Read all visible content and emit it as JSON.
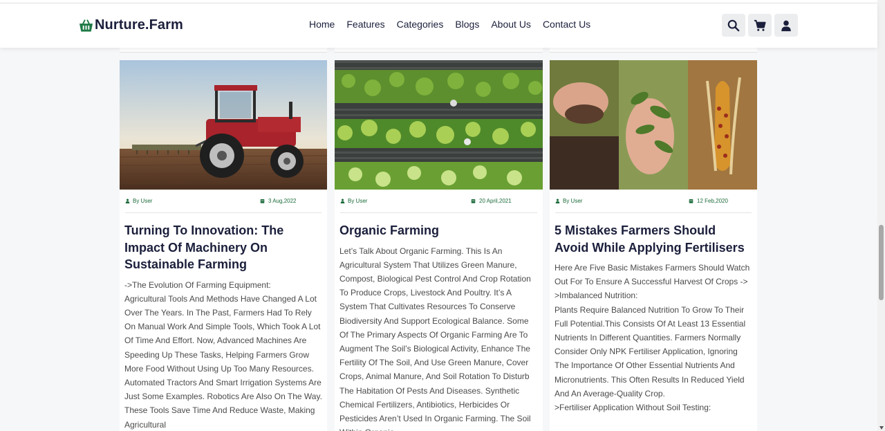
{
  "header": {
    "logo_text": "Nurture.Farm",
    "nav": [
      "Home",
      "Features",
      "Categories",
      "Blogs",
      "About Us",
      "Contact Us"
    ],
    "icons": [
      "search-icon",
      "cart-icon",
      "user-icon"
    ]
  },
  "colors": {
    "brand_green": "#1f7a45",
    "navy": "#1b1f3b",
    "meta_green": "#1b6b3a"
  },
  "cards": [
    {
      "image": "red tractor on plowed field",
      "author": "By User",
      "date": "3 Aug,2022",
      "title": "Turning To Innovation: The Impact Of Machinery On Sustainable Farming",
      "body": "->The Evolution Of Farming Equipment:\nAgricultural Tools And Methods Have Changed A Lot Over The Years. In The Past, Farmers Had To Rely On Manual Work And Simple Tools, Which Took A Lot Of Time And Effort. Now, Advanced Machines Are Speeding Up These Tasks, Helping Farmers Grow More Food Without Using Up Too Many Resources. Automated Tractors And Smart Irrigation Systems Are Just Some Examples. Robotics Are Also On The Way. These Tools Save Time And Reduce Waste, Making Agricultural"
    },
    {
      "image": "aerial view of organic crop rows",
      "author": "By User",
      "date": "20 April,2021",
      "title": "Organic Farming",
      "body": "Let’s Talk About Organic Farming. This Is An Agricultural System That Utilizes Green Manure, Compost, Biological Pest Control And Crop Rotation To Produce Crops, Livestock And Poultry. It’s A System That Cultivates Resources To Conserve Biodiversity And Support Ecological Balance. Some Of The Primary Aspects Of Organic Farming Are To Augment The Soil’s Biological Activity, Enhance The Fertility Of The Soil, And Use Green Manure, Cover Crops, Animal Manure, And Soil Rotation To Disturb The Habitation Of Pests And Diseases. Synthetic Chemical Fertilizers, Antibiotics, Herbicides Or Pesticides Aren’t Used In Organic Farming. The Soil Within Organic"
    },
    {
      "image": "soil, diseased plant and corn collage",
      "author": "By User",
      "date": "12 Feb,2020",
      "title": "5 Mistakes Farmers Should Avoid While Applying Fertilisers",
      "body": "Here Are Five Basic Mistakes Farmers Should Watch Out For To Ensure A Successful Harvest Of Crops ->\n>Imbalanced Nutrition:\nPlants Require Balanced Nutrition To Grow To Their Full Potential.This Consists Of At Least 13 Essential Nutrients In Different Quantities. Farmers Normally Consider Only NPK Fertiliser Application, Ignoring The Importance Of Other Essential Nutrients And Micronutrients. This Often Results In Reduced Yield And An Average-Quality Crop.\n>Fertiliser Application Without Soil Testing:"
    }
  ]
}
